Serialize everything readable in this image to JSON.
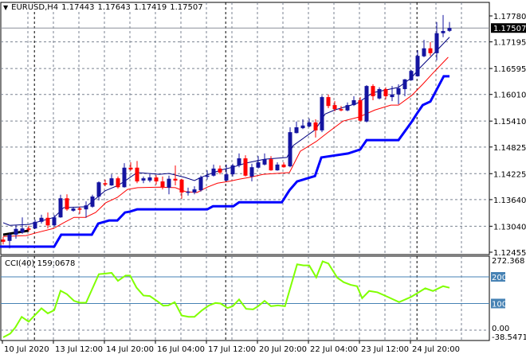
{
  "header": {
    "symbol": "EURUSD,H4",
    "open": "1.17443",
    "high": "1.17643",
    "low": "1.17419",
    "close": "1.17507",
    "menu_icon": "triangle-down-icon"
  },
  "colors": {
    "bull": "#1414a0",
    "bear": "#ff0000",
    "fast_ma": "#000080",
    "slow_ma": "#ff0000",
    "step_line": "#0000ff",
    "black_line": "#000000",
    "cci": "#80ff00",
    "cci_level": "#4682b4",
    "grid": "#7a8290",
    "current_price_bg": "#000000"
  },
  "price_axis": {
    "labels": [
      "1.17780",
      "1.17195",
      "1.16595",
      "1.16010",
      "1.15410",
      "1.14825",
      "1.14225",
      "1.13640",
      "1.13040",
      "1.12455"
    ],
    "current_price": "1.17507"
  },
  "cci_panel": {
    "title": "CCI(40) 159.0678",
    "max_label": "272.368",
    "min_label": "-38.5471",
    "levels": [
      "200",
      "100"
    ],
    "zero_label": "0.00"
  },
  "time_axis": {
    "labels": [
      {
        "text": "10 Jul 2020",
        "bar": 0
      },
      {
        "text": "13 Jul 12:00",
        "bar": 8
      },
      {
        "text": "14 Jul 20:00",
        "bar": 16
      },
      {
        "text": "16 Jul 04:00",
        "bar": 24
      },
      {
        "text": "17 Jul 12:00",
        "bar": 32
      },
      {
        "text": "20 Jul 20:00",
        "bar": 40
      },
      {
        "text": "22 Jul 04:00",
        "bar": 48
      },
      {
        "text": "23 Jul 12:00",
        "bar": 56
      },
      {
        "text": "24 Jul 20:00",
        "bar": 64
      }
    ],
    "week_separators": [
      4.9,
      34.9,
      64.9
    ]
  },
  "chart_data": {
    "type": "candlestick",
    "title": "EURUSD,H4",
    "ylim": [
      1.12455,
      1.1778
    ],
    "candles_ohlc": [
      [
        1.1274,
        1.128,
        1.1263,
        1.1269
      ],
      [
        1.1271,
        1.1289,
        1.1254,
        1.1285
      ],
      [
        1.1285,
        1.1306,
        1.1276,
        1.1298
      ],
      [
        1.129,
        1.1324,
        1.1287,
        1.1299
      ],
      [
        1.1299,
        1.1305,
        1.1292,
        1.1296
      ],
      [
        1.1299,
        1.1319,
        1.1298,
        1.1314
      ],
      [
        1.1314,
        1.133,
        1.131,
        1.1323
      ],
      [
        1.1323,
        1.1335,
        1.1299,
        1.1306
      ],
      [
        1.1306,
        1.133,
        1.1303,
        1.1324
      ],
      [
        1.1324,
        1.1375,
        1.1323,
        1.1367
      ],
      [
        1.1367,
        1.1376,
        1.1339,
        1.1342
      ],
      [
        1.1339,
        1.1348,
        1.1337,
        1.1344
      ],
      [
        1.1344,
        1.1348,
        1.1332,
        1.1342
      ],
      [
        1.1342,
        1.136,
        1.1323,
        1.1351
      ],
      [
        1.1348,
        1.1375,
        1.1346,
        1.1371
      ],
      [
        1.1371,
        1.1405,
        1.1362,
        1.1403
      ],
      [
        1.1401,
        1.1409,
        1.1394,
        1.1398
      ],
      [
        1.1396,
        1.1421,
        1.1395,
        1.1412
      ],
      [
        1.1412,
        1.1416,
        1.1389,
        1.1392
      ],
      [
        1.1392,
        1.1446,
        1.1391,
        1.1436
      ],
      [
        1.1436,
        1.1448,
        1.1429,
        1.1432
      ],
      [
        1.1436,
        1.1451,
        1.1401,
        1.1405
      ],
      [
        1.1407,
        1.1416,
        1.1401,
        1.1412
      ],
      [
        1.1407,
        1.1421,
        1.1403,
        1.1414
      ],
      [
        1.1414,
        1.1419,
        1.1398,
        1.1405
      ],
      [
        1.1405,
        1.1416,
        1.1387,
        1.1392
      ],
      [
        1.1391,
        1.1418,
        1.1376,
        1.1411
      ],
      [
        1.1411,
        1.1441,
        1.1396,
        1.1407
      ],
      [
        1.1409,
        1.1411,
        1.1366,
        1.138
      ],
      [
        1.138,
        1.1391,
        1.1373,
        1.1382
      ],
      [
        1.138,
        1.1394,
        1.1376,
        1.1387
      ],
      [
        1.1385,
        1.1418,
        1.1382,
        1.1414
      ],
      [
        1.1416,
        1.143,
        1.1409,
        1.1418
      ],
      [
        1.1418,
        1.1443,
        1.1416,
        1.1434
      ],
      [
        1.1434,
        1.1441,
        1.1421,
        1.1425
      ],
      [
        1.1407,
        1.1443,
        1.1405,
        1.1421
      ],
      [
        1.1421,
        1.1445,
        1.1416,
        1.1441
      ],
      [
        1.1441,
        1.1468,
        1.1437,
        1.1457
      ],
      [
        1.1457,
        1.1464,
        1.1416,
        1.1418
      ],
      [
        1.1416,
        1.1445,
        1.1405,
        1.1437
      ],
      [
        1.1436,
        1.1462,
        1.1434,
        1.1448
      ],
      [
        1.1443,
        1.1468,
        1.1441,
        1.1455
      ],
      [
        1.1455,
        1.1462,
        1.1429,
        1.143
      ],
      [
        1.143,
        1.1448,
        1.1429,
        1.1443
      ],
      [
        1.1443,
        1.1448,
        1.1436,
        1.1437
      ],
      [
        1.1439,
        1.1527,
        1.1437,
        1.1516
      ],
      [
        1.1514,
        1.154,
        1.1513,
        1.1527
      ],
      [
        1.1525,
        1.1545,
        1.1523,
        1.1531
      ],
      [
        1.1529,
        1.1547,
        1.1527,
        1.1538
      ],
      [
        1.1538,
        1.1545,
        1.1504,
        1.152
      ],
      [
        1.152,
        1.1599,
        1.1516,
        1.1595
      ],
      [
        1.1595,
        1.1601,
        1.157,
        1.1575
      ],
      [
        1.1577,
        1.1586,
        1.1563,
        1.1568
      ],
      [
        1.1568,
        1.1575,
        1.1563,
        1.1565
      ],
      [
        1.1565,
        1.1583,
        1.1563,
        1.1577
      ],
      [
        1.1577,
        1.1597,
        1.1575,
        1.1588
      ],
      [
        1.1588,
        1.1595,
        1.154,
        1.1542
      ],
      [
        1.154,
        1.1622,
        1.1538,
        1.162
      ],
      [
        1.162,
        1.1624,
        1.1588,
        1.1597
      ],
      [
        1.1592,
        1.1617,
        1.159,
        1.1613
      ],
      [
        1.1613,
        1.1617,
        1.159,
        1.1597
      ],
      [
        1.1595,
        1.162,
        1.1586,
        1.1601
      ],
      [
        1.1601,
        1.1624,
        1.1579,
        1.1615
      ],
      [
        1.1613,
        1.1636,
        1.1597,
        1.1635
      ],
      [
        1.1633,
        1.1656,
        1.1632,
        1.1654
      ],
      [
        1.1642,
        1.1701,
        1.1641,
        1.1688
      ],
      [
        1.1687,
        1.1724,
        1.1685,
        1.1705
      ],
      [
        1.1705,
        1.1719,
        1.1688,
        1.1694
      ],
      [
        1.1694,
        1.1764,
        1.1678,
        1.1739
      ],
      [
        1.1739,
        1.178,
        1.173,
        1.1744
      ],
      [
        1.17443,
        1.17643,
        1.17419,
        1.17507
      ]
    ],
    "fast_ma": [
      [
        0,
        1.1312
      ],
      [
        1,
        1.1306
      ],
      [
        4,
        1.1308
      ],
      [
        8,
        1.1324
      ],
      [
        9.5,
        1.1346
      ],
      [
        13,
        1.1348
      ],
      [
        14.5,
        1.1366
      ],
      [
        16,
        1.1384
      ],
      [
        18,
        1.1396
      ],
      [
        19,
        1.1405
      ],
      [
        21,
        1.1425
      ],
      [
        24.5,
        1.1421
      ],
      [
        26,
        1.1423
      ],
      [
        28.5,
        1.1414
      ],
      [
        30,
        1.1407
      ],
      [
        31,
        1.1414
      ],
      [
        33,
        1.1425
      ],
      [
        34.5,
        1.1432
      ],
      [
        36,
        1.1437
      ],
      [
        38,
        1.1446
      ],
      [
        41,
        1.1455
      ],
      [
        44.5,
        1.1459
      ],
      [
        45.5,
        1.1486
      ],
      [
        49,
        1.1522
      ],
      [
        50.5,
        1.1557
      ],
      [
        52,
        1.1566
      ],
      [
        55.5,
        1.1581
      ],
      [
        58,
        1.1605
      ],
      [
        62,
        1.1617
      ],
      [
        64,
        1.1638
      ],
      [
        65.5,
        1.1663
      ],
      [
        67,
        1.1685
      ],
      [
        70,
        1.173
      ]
    ],
    "slow_ma": [
      [
        0,
        1.1281
      ],
      [
        3.6,
        1.1283
      ],
      [
        5.4,
        1.129
      ],
      [
        7.9,
        1.1299
      ],
      [
        9.5,
        1.1312
      ],
      [
        11.1,
        1.1324
      ],
      [
        12.9,
        1.1324
      ],
      [
        14.5,
        1.1335
      ],
      [
        16.1,
        1.1357
      ],
      [
        17.9,
        1.1369
      ],
      [
        19.5,
        1.1387
      ],
      [
        21.1,
        1.1391
      ],
      [
        24.5,
        1.1392
      ],
      [
        27,
        1.1391
      ],
      [
        28.6,
        1.1382
      ],
      [
        30.4,
        1.138
      ],
      [
        32,
        1.1392
      ],
      [
        33.6,
        1.1401
      ],
      [
        35.4,
        1.1405
      ],
      [
        37,
        1.141
      ],
      [
        38.6,
        1.1414
      ],
      [
        40.8,
        1.1421
      ],
      [
        44.9,
        1.1425
      ],
      [
        46.6,
        1.1473
      ],
      [
        49.1,
        1.1495
      ],
      [
        50.8,
        1.1514
      ],
      [
        53.3,
        1.1541
      ],
      [
        55.8,
        1.155
      ],
      [
        58.3,
        1.1566
      ],
      [
        60.8,
        1.1577
      ],
      [
        62,
        1.1577
      ],
      [
        64.1,
        1.1599
      ],
      [
        65.8,
        1.1624
      ],
      [
        67.4,
        1.1649
      ],
      [
        69.8,
        1.1685
      ]
    ],
    "step_line": [
      [
        -0.5,
        1.1258
      ],
      [
        8,
        1.1258
      ],
      [
        9.1,
        1.1285
      ],
      [
        13.9,
        1.1285
      ],
      [
        14.9,
        1.131
      ],
      [
        16.6,
        1.1317
      ],
      [
        17.9,
        1.1317
      ],
      [
        19.1,
        1.1335
      ],
      [
        19.9,
        1.1337
      ],
      [
        21,
        1.1342
      ],
      [
        32,
        1.1342
      ],
      [
        32.9,
        1.1349
      ],
      [
        36.1,
        1.1349
      ],
      [
        37,
        1.1358
      ],
      [
        43.7,
        1.1358
      ],
      [
        44.9,
        1.1385
      ],
      [
        46.1,
        1.1405
      ],
      [
        48.9,
        1.1417
      ],
      [
        49.9,
        1.1459
      ],
      [
        54.1,
        1.1468
      ],
      [
        56,
        1.1477
      ],
      [
        57,
        1.1498
      ],
      [
        62,
        1.1498
      ],
      [
        64.1,
        1.154
      ],
      [
        64.9,
        1.1558
      ],
      [
        65.8,
        1.1577
      ],
      [
        67,
        1.1585
      ],
      [
        69.1,
        1.1642
      ],
      [
        70,
        1.1642
      ]
    ],
    "black_line": [
      [
        0,
        1.1285
      ],
      [
        4,
        1.1294
      ]
    ],
    "cci": {
      "ylim": [
        -38.5471,
        272.368
      ],
      "levels": [
        200,
        100,
        0
      ],
      "points": [
        [
          0,
          -27
        ],
        [
          1.1,
          -13
        ],
        [
          1.9,
          10
        ],
        [
          2.9,
          50
        ],
        [
          4,
          32
        ],
        [
          5,
          57
        ],
        [
          6,
          82
        ],
        [
          7,
          63
        ],
        [
          8,
          75
        ],
        [
          9,
          148
        ],
        [
          10,
          135
        ],
        [
          11.1,
          110
        ],
        [
          12,
          103
        ],
        [
          13,
          103
        ],
        [
          15,
          210
        ],
        [
          15.9,
          212
        ],
        [
          17,
          215
        ],
        [
          18,
          185
        ],
        [
          19.2,
          205
        ],
        [
          19.9,
          205
        ],
        [
          20.9,
          160
        ],
        [
          22,
          130
        ],
        [
          23,
          128
        ],
        [
          24.1,
          110
        ],
        [
          25.1,
          92
        ],
        [
          25.9,
          93
        ],
        [
          26.9,
          105
        ],
        [
          28,
          55
        ],
        [
          29.1,
          50
        ],
        [
          30,
          50
        ],
        [
          31.2,
          75
        ],
        [
          32.3,
          93
        ],
        [
          33.3,
          102
        ],
        [
          34.1,
          100
        ],
        [
          35.2,
          83
        ],
        [
          36,
          90
        ],
        [
          37,
          115
        ],
        [
          38.1,
          80
        ],
        [
          39.2,
          78
        ],
        [
          40,
          90
        ],
        [
          41,
          110
        ],
        [
          42,
          90
        ],
        [
          43.1,
          93
        ],
        [
          44.2,
          90
        ],
        [
          46.1,
          247
        ],
        [
          47.1,
          243
        ],
        [
          48,
          243
        ],
        [
          49.1,
          198
        ],
        [
          50.1,
          258
        ],
        [
          51,
          250
        ],
        [
          52.4,
          197
        ],
        [
          53.4,
          180
        ],
        [
          54.5,
          170
        ],
        [
          55.5,
          165
        ],
        [
          56.3,
          120
        ],
        [
          57.4,
          147
        ],
        [
          58.7,
          142
        ],
        [
          60.3,
          125
        ],
        [
          62.1,
          105
        ],
        [
          64,
          125
        ],
        [
          66.2,
          157
        ],
        [
          67.4,
          147
        ],
        [
          69,
          165
        ],
        [
          70,
          159.0678
        ]
      ]
    }
  }
}
